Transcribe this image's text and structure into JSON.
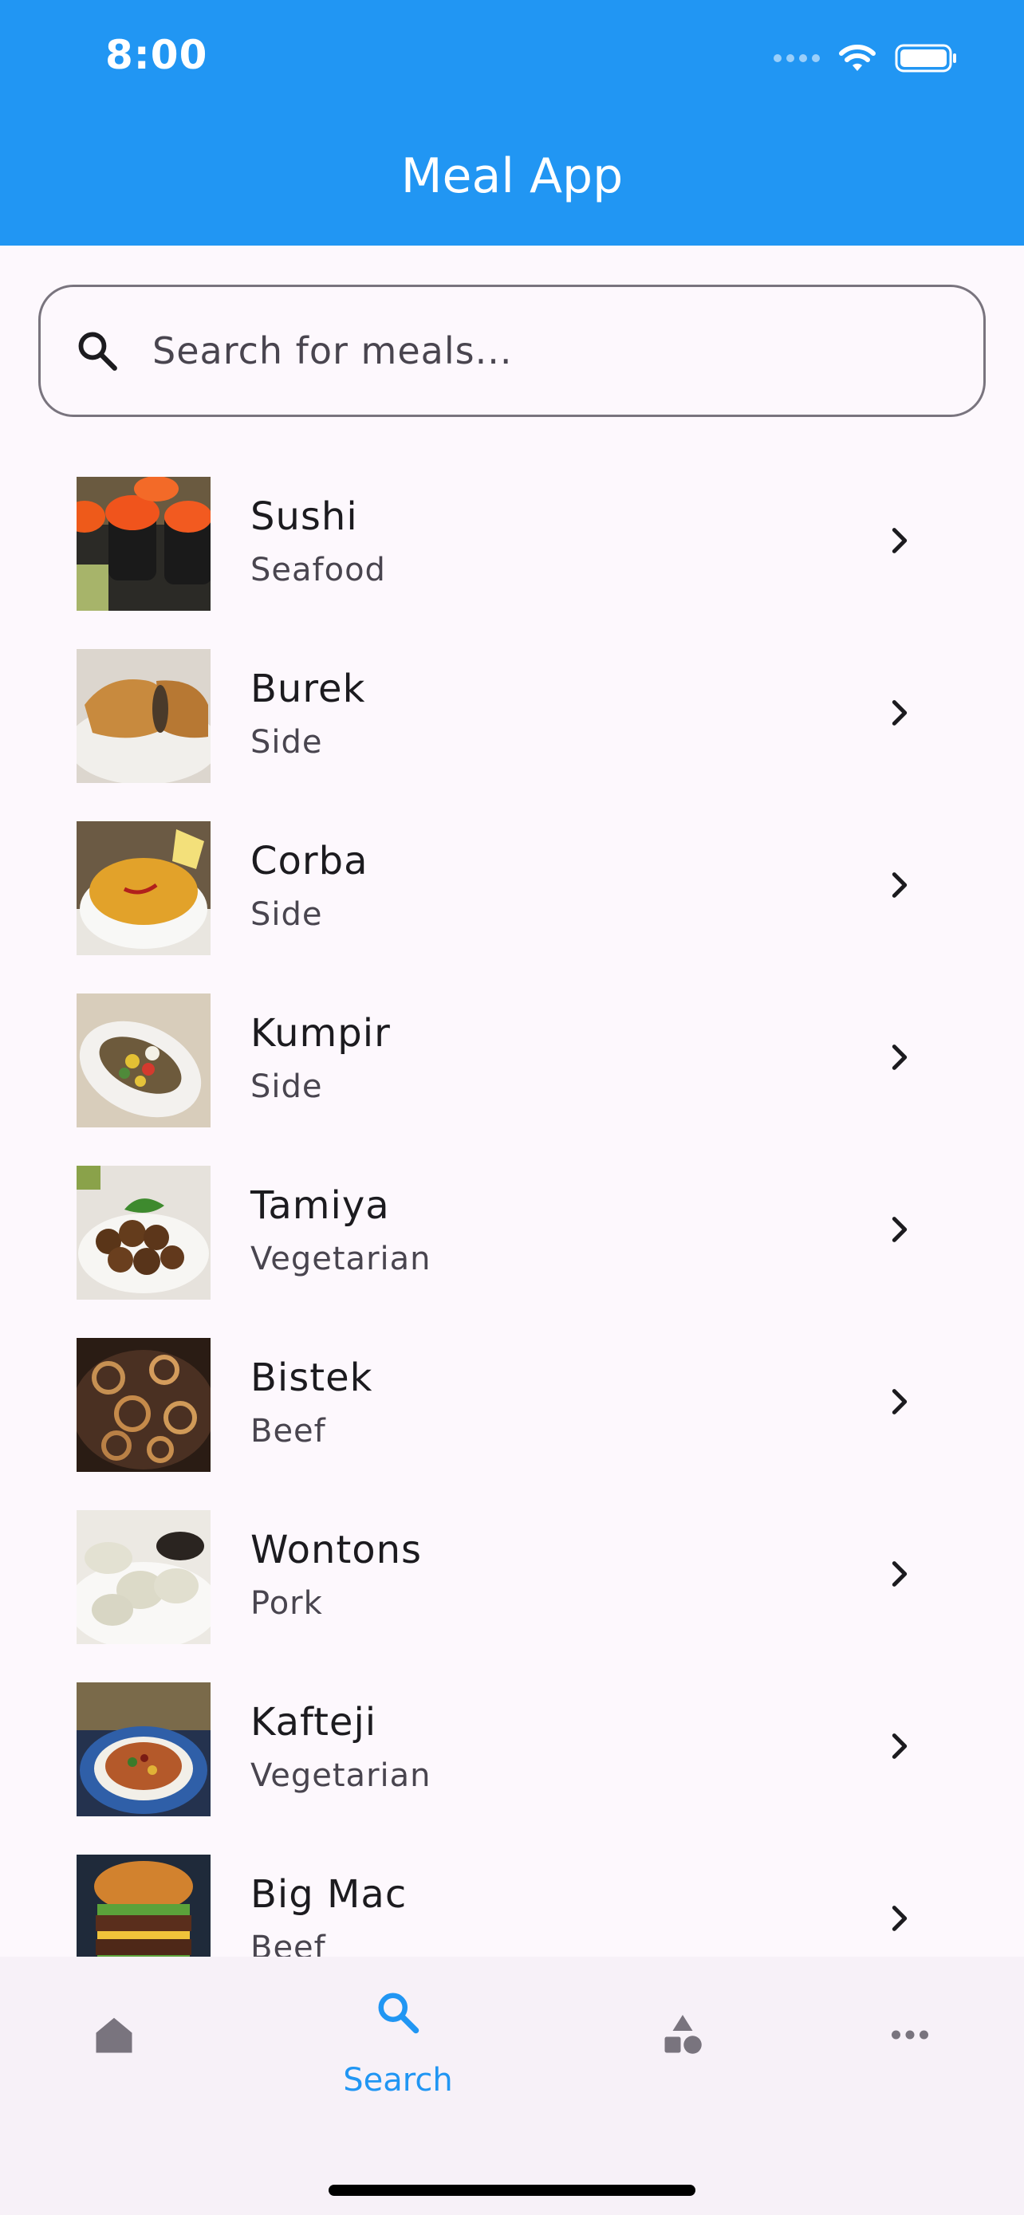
{
  "status_bar": {
    "time": "8:00"
  },
  "app_bar": {
    "title": "Meal App"
  },
  "search": {
    "placeholder": "Search for meals..."
  },
  "meals": [
    {
      "name": "Sushi",
      "category": "Seafood"
    },
    {
      "name": "Burek",
      "category": "Side"
    },
    {
      "name": "Corba",
      "category": "Side"
    },
    {
      "name": "Kumpir",
      "category": "Side"
    },
    {
      "name": "Tamiya",
      "category": "Vegetarian"
    },
    {
      "name": "Bistek",
      "category": "Beef"
    },
    {
      "name": "Wontons",
      "category": "Pork"
    },
    {
      "name": "Kafteji",
      "category": "Vegetarian"
    },
    {
      "name": "Big Mac",
      "category": "Beef"
    }
  ],
  "bottom_nav": {
    "items": [
      {
        "icon": "home-icon",
        "label": ""
      },
      {
        "icon": "search-icon",
        "label": "Search",
        "active": true
      },
      {
        "icon": "categories-icon",
        "label": ""
      },
      {
        "icon": "more-icon",
        "label": ""
      }
    ]
  },
  "colors": {
    "primary": "#2196F3",
    "background": "#FDF8FD",
    "nav_background": "#F7F1F8",
    "inactive_icon": "#79747E"
  }
}
